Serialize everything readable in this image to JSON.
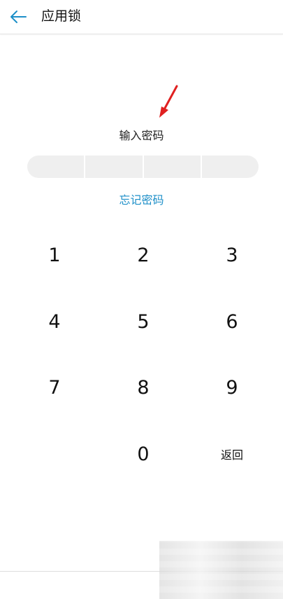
{
  "header": {
    "title": "应用锁",
    "back_icon": "arrow-left-icon",
    "accent_color": "#1d8fc8"
  },
  "lock": {
    "prompt": "输入密码",
    "pin_slots": 4,
    "forgot_label": "忘记密码",
    "annotation_color": "#e02020"
  },
  "keypad": {
    "keys": [
      "1",
      "2",
      "3",
      "4",
      "5",
      "6",
      "7",
      "8",
      "9",
      "0"
    ],
    "back_label": "返回"
  }
}
